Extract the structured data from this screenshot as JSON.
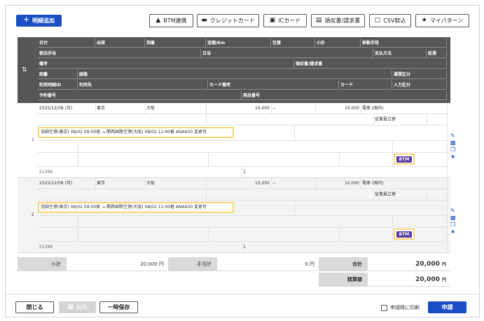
{
  "toolbar": {
    "add_detail": "明細追加",
    "btm_link": "BTM連携",
    "credit_card": "クレジットカード",
    "ic_card": "ICカード",
    "receipt": "領収書/請求書",
    "csv_import": "CSV取込",
    "my_pattern": "マイパターン"
  },
  "header": {
    "r1": [
      "日付",
      "出発",
      "到着",
      "金額/Km",
      "往復",
      "小計",
      "移動手段"
    ],
    "r2": [
      "宿泊手当",
      "日当",
      "支払方法",
      "証憑"
    ],
    "r3": [
      "備考",
      "領収書/請求書"
    ],
    "r4": [
      "距離",
      "経路",
      "運賃区分"
    ],
    "r5": [
      "利用明細ID",
      "利用先",
      "カード備考",
      "カード",
      "入力区分"
    ],
    "r6": [
      "予約番号",
      "商品番号"
    ]
  },
  "rows": [
    {
      "index": "1",
      "date": "2025/12/08 (月)",
      "from": "東京",
      "to": "大阪",
      "amount": "10,000",
      "roundtrip": "--",
      "subtotal": "10,000",
      "transport": "電車 (国内)",
      "payment": "従業員立替",
      "remark": "羽田空港(東京) 08/02 09:00発 → 関西国際空港(大阪) 08/02 11:00着 ANA930 変更可",
      "source": "BTM",
      "reservation": "51399",
      "product": "1"
    },
    {
      "index": "2",
      "date": "2025/12/08 (月)",
      "from": "東京",
      "to": "大阪",
      "amount": "10,000",
      "roundtrip": "--",
      "subtotal": "10,000",
      "transport": "電車 (国内)",
      "payment": "従業員立替",
      "remark": "羽田空港(東京) 08/02 09:00発 → 関西国際空港(大阪) 08/02 11:00着 ANA930 変更可",
      "source": "BTM",
      "reservation": "51399",
      "product": "1"
    }
  ],
  "summary": {
    "subtotal_label": "小計",
    "subtotal_value": "20,000 円",
    "allowance_label": "手当計",
    "allowance_value": "0 円",
    "total_label": "合計",
    "total_value": "20,000",
    "total_unit": "円",
    "settle_label": "精算額",
    "settle_value": "20,000",
    "settle_unit": "円"
  },
  "footer": {
    "close": "閉じる",
    "delete": "削除",
    "temp_save": "一時保存",
    "print_on_apply": "申請時に印刷",
    "apply": "申請"
  },
  "colors": {
    "primary": "#1a4fc4",
    "header_bg": "#565656",
    "highlight": "#f5d77a",
    "btm": "#5b3aa0"
  }
}
